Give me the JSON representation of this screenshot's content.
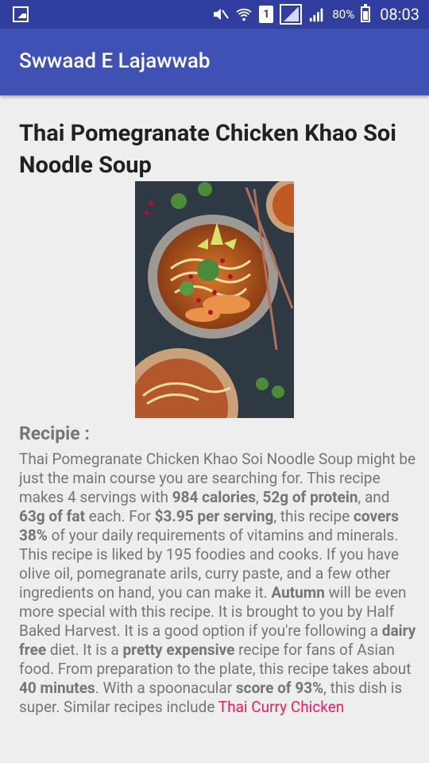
{
  "status_bar": {
    "battery": "80%",
    "time": "08:03",
    "sim_slot": "1",
    "icons": [
      "gallery-icon",
      "mute-icon",
      "wifi-icon",
      "sim-icon",
      "signal-icon",
      "battery-icon"
    ]
  },
  "app_bar": {
    "title": "Swwaad E Lajawwab",
    "color": "#3f51b5"
  },
  "recipe": {
    "title": "Thai Pomegranate Chicken Khao Soi Noodle Soup",
    "section_label": "Recipie :",
    "desc": [
      "Thai Pomegranate Chicken Khao Soi Noodle Soup might be just the main course you are searching for. This recipe makes 4 servings with ",
      "984 calories",
      ", ",
      "52g of protein",
      ", and ",
      "63g of fat",
      " each. For ",
      "$3.95 per serving",
      ", this recipe ",
      "covers 38%",
      " of your daily requirements of vitamins and minerals. This recipe is liked by 195 foodies and cooks. If you have olive oil, pomegranate arils, curry paste, and a few other ingredients on hand, you can make it. ",
      "Autumn",
      " will be even more special with this recipe. It is brought to you by Half Baked Harvest. It is a good option if you're following a ",
      "dairy free",
      " diet. It is a ",
      "pretty expensive",
      " recipe for fans of Asian food. From preparation to the plate, this recipe takes about ",
      "40 minutes",
      ". With a spoonacular ",
      "score of 93%",
      ", this dish is super. Similar recipes include ",
      "Thai Curry Chicken"
    ]
  }
}
